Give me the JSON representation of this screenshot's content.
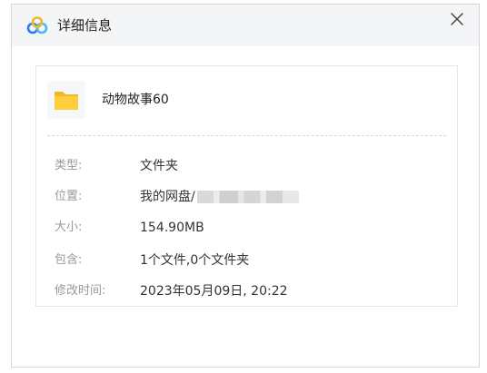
{
  "dialog": {
    "title": "详细信息",
    "icons": {
      "app": "baidu-netdisk-logo-icon",
      "close": "close-icon",
      "item": "folder-icon"
    },
    "colors": {
      "brand_blue": "#2f7bf5",
      "brand_light": "#49b9f4",
      "folder": "#ffce3d",
      "folder_dark": "#f1b724"
    }
  },
  "file": {
    "name": "动物故事60",
    "type_label": "类型:",
    "type_value": "文件夹",
    "location_label": "位置:",
    "location_value": "我的网盘/",
    "size_label": "大小:",
    "size_value": "154.90MB",
    "contains_label": "包含:",
    "contains_value": "1个文件,0个文件夹",
    "modified_label": "修改时间:",
    "modified_value": "2023年05月09日, 20:22"
  }
}
